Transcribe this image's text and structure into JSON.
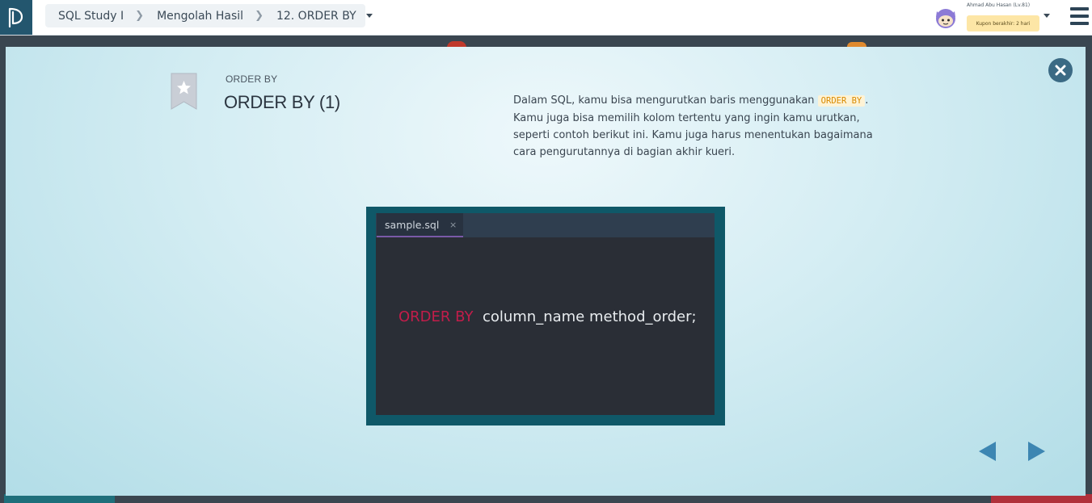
{
  "header": {
    "breadcrumb": [
      "SQL Study I",
      "Mengolah Hasil",
      "12. ORDER BY"
    ],
    "user_name": "Ahmad Abu Hasan (Lv.81)",
    "coupon_text": "Kupon berakhir: 2 hari"
  },
  "slide": {
    "subtitle": "ORDER BY",
    "title": "ORDER BY (1)",
    "description_before": "Dalam SQL, kamu bisa mengurutkan baris menggunakan ",
    "description_code": "ORDER BY",
    "description_after": ". Kamu juga bisa memilih kolom tertentu yang ingin kamu urutkan, seperti contoh berikut ini. Kamu juga harus menentukan bagaimana cara pengurutannya di bagian akhir kueri."
  },
  "code_editor": {
    "tab_name": "sample.sql",
    "tab_close": "×",
    "keyword": "ORDER BY",
    "rest": "column_name  method_order;"
  },
  "colors": {
    "modal_accent": "#3b6a84",
    "keyword": "#c21d4a",
    "nav_arrow": "#3d86b2"
  },
  "icons": [
    "logo-icon",
    "chevron-right-icon",
    "caret-down-icon",
    "avatar-icon",
    "menu-icon",
    "bookmark-star-icon",
    "close-icon",
    "prev-arrow-icon",
    "next-arrow-icon"
  ]
}
